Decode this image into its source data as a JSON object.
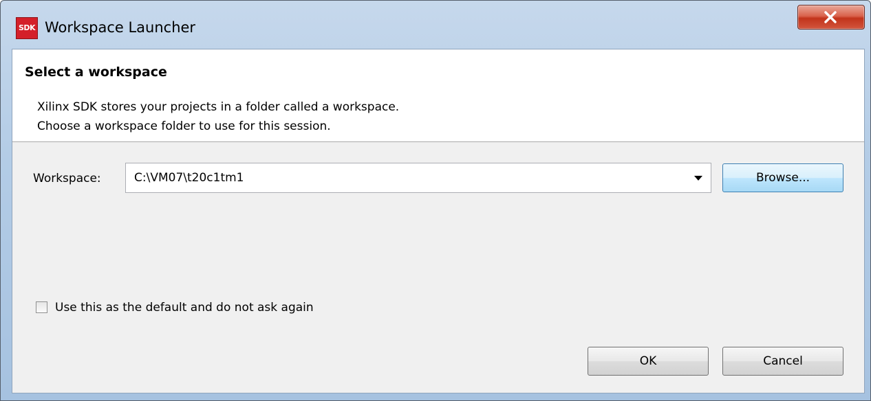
{
  "window": {
    "title": "Workspace Launcher",
    "app_icon_text": "SDK",
    "app_icon_name": "xilinx-sdk-icon",
    "close_icon_name": "close-icon"
  },
  "header": {
    "title": "Select a workspace",
    "line1": "Xilinx SDK stores your projects in a folder called a workspace.",
    "line2": "Choose a workspace folder to use for this session."
  },
  "workspace": {
    "label": "Workspace:",
    "value": "C:\\VM07\\t20c1tm1",
    "dropdown_icon_name": "chevron-down-icon",
    "browse_label": "Browse..."
  },
  "default_checkbox": {
    "label": "Use this as the default and do not ask again",
    "checked": false
  },
  "buttons": {
    "ok_label": "OK",
    "cancel_label": "Cancel"
  },
  "colors": {
    "titlebar": "#b3cce6",
    "close_button": "#c2341b",
    "dialog_background": "#f0f0f0",
    "header_background": "#ffffff",
    "browse_focus_border": "#3c7fb1"
  }
}
